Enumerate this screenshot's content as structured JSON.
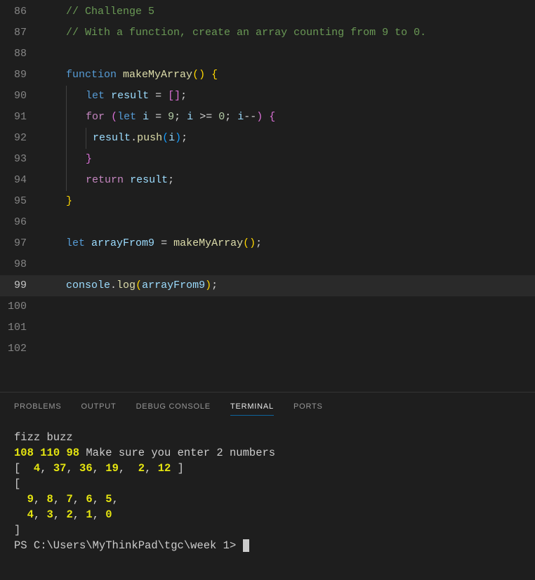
{
  "editor": {
    "active_line": 99,
    "lines": [
      {
        "num": 86,
        "tokens": [
          [
            "sp",
            "    "
          ],
          [
            "comment",
            "// Challenge 5"
          ]
        ]
      },
      {
        "num": 87,
        "tokens": [
          [
            "sp",
            "    "
          ],
          [
            "comment",
            "// With a function, create an array counting from 9 to 0."
          ]
        ]
      },
      {
        "num": 88,
        "tokens": []
      },
      {
        "num": 89,
        "tokens": [
          [
            "sp",
            "    "
          ],
          [
            "keyword",
            "function"
          ],
          [
            "op",
            " "
          ],
          [
            "func",
            "makeMyArray"
          ],
          [
            "paren",
            "()"
          ],
          [
            "op",
            " "
          ],
          [
            "paren",
            "{"
          ]
        ]
      },
      {
        "num": 90,
        "tokens": [
          [
            "sp",
            "    "
          ],
          [
            "guide",
            ""
          ],
          [
            "sp",
            "   "
          ],
          [
            "keyword",
            "let"
          ],
          [
            "op",
            " "
          ],
          [
            "var",
            "result"
          ],
          [
            "op",
            " = "
          ],
          [
            "paren2",
            "[]"
          ],
          [
            "op",
            ";"
          ]
        ]
      },
      {
        "num": 91,
        "tokens": [
          [
            "sp",
            "    "
          ],
          [
            "guide",
            ""
          ],
          [
            "sp",
            "   "
          ],
          [
            "control",
            "for"
          ],
          [
            "op",
            " "
          ],
          [
            "paren2",
            "("
          ],
          [
            "keyword",
            "let"
          ],
          [
            "op",
            " "
          ],
          [
            "var",
            "i"
          ],
          [
            "op",
            " = "
          ],
          [
            "num",
            "9"
          ],
          [
            "op",
            "; "
          ],
          [
            "var",
            "i"
          ],
          [
            "op",
            " >= "
          ],
          [
            "num",
            "0"
          ],
          [
            "op",
            "; "
          ],
          [
            "var",
            "i"
          ],
          [
            "op",
            "--"
          ],
          [
            "paren2",
            ")"
          ],
          [
            "op",
            " "
          ],
          [
            "paren2",
            "{"
          ]
        ]
      },
      {
        "num": 92,
        "tokens": [
          [
            "sp",
            "    "
          ],
          [
            "guide",
            ""
          ],
          [
            "sp",
            "   "
          ],
          [
            "guide",
            ""
          ],
          [
            "sp",
            " "
          ],
          [
            "var",
            "result"
          ],
          [
            "op",
            "."
          ],
          [
            "func",
            "push"
          ],
          [
            "paren3",
            "("
          ],
          [
            "var",
            "i"
          ],
          [
            "paren3",
            ")"
          ],
          [
            "op",
            ";"
          ]
        ]
      },
      {
        "num": 93,
        "tokens": [
          [
            "sp",
            "    "
          ],
          [
            "guide",
            ""
          ],
          [
            "sp",
            "   "
          ],
          [
            "paren2",
            "}"
          ]
        ]
      },
      {
        "num": 94,
        "tokens": [
          [
            "sp",
            "    "
          ],
          [
            "guide",
            ""
          ],
          [
            "sp",
            "   "
          ],
          [
            "control",
            "return"
          ],
          [
            "op",
            " "
          ],
          [
            "var",
            "result"
          ],
          [
            "op",
            ";"
          ]
        ]
      },
      {
        "num": 95,
        "tokens": [
          [
            "sp",
            "    "
          ],
          [
            "paren",
            "}"
          ]
        ]
      },
      {
        "num": 96,
        "tokens": []
      },
      {
        "num": 97,
        "tokens": [
          [
            "sp",
            "    "
          ],
          [
            "keyword",
            "let"
          ],
          [
            "op",
            " "
          ],
          [
            "var",
            "arrayFrom9"
          ],
          [
            "op",
            " = "
          ],
          [
            "func",
            "makeMyArray"
          ],
          [
            "paren",
            "()"
          ],
          [
            "op",
            ";"
          ]
        ]
      },
      {
        "num": 98,
        "tokens": []
      },
      {
        "num": 99,
        "tokens": [
          [
            "sp",
            "    "
          ],
          [
            "var",
            "console"
          ],
          [
            "op",
            "."
          ],
          [
            "func",
            "log"
          ],
          [
            "paren",
            "("
          ],
          [
            "var",
            "arrayFrom9"
          ],
          [
            "paren",
            ")"
          ],
          [
            "op",
            ";"
          ]
        ]
      },
      {
        "num": 100,
        "tokens": []
      },
      {
        "num": 101,
        "tokens": []
      },
      {
        "num": 102,
        "tokens": []
      }
    ]
  },
  "panel": {
    "tabs": [
      {
        "label": "PROBLEMS",
        "active": false
      },
      {
        "label": "OUTPUT",
        "active": false
      },
      {
        "label": "DEBUG CONSOLE",
        "active": false
      },
      {
        "label": "TERMINAL",
        "active": true
      },
      {
        "label": "PORTS",
        "active": false
      }
    ],
    "terminal": {
      "line1": "fizz buzz",
      "line2_nums": [
        "108",
        "110",
        "98"
      ],
      "line2_rest": " Make sure you enter 2 numbers",
      "arr1": [
        "4",
        "37",
        "36",
        "19",
        "2",
        "12"
      ],
      "arr2_row1": [
        "9",
        "8",
        "7",
        "6",
        "5"
      ],
      "arr2_row2": [
        "4",
        "3",
        "2",
        "1",
        "0"
      ],
      "prompt": "PS C:\\Users\\MyThinkPad\\tgc\\week 1> "
    }
  }
}
